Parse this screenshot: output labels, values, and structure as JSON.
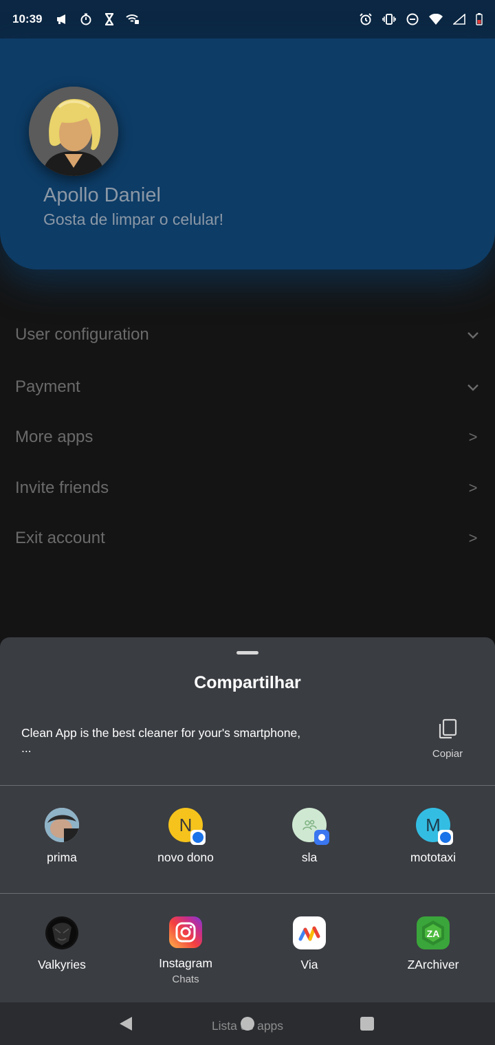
{
  "status_bar": {
    "time": "10:39",
    "left_icons": [
      "megaphone-icon",
      "stopwatch-icon",
      "hourglass-icon",
      "wifi-calling-icon"
    ],
    "right_icons": [
      "alarm-icon",
      "vibrate-icon",
      "dnd-icon",
      "wifi-icon",
      "signal-icon",
      "battery-icon"
    ]
  },
  "profile": {
    "name": "Apollo Daniel",
    "tagline": "Gosta de limpar o celular!"
  },
  "menu": [
    {
      "label": "User configuration",
      "arrow": "chevron-down"
    },
    {
      "label": "Payment",
      "arrow": "chevron-down"
    },
    {
      "label": "More apps",
      "arrow": ">"
    },
    {
      "label": "Invite friends",
      "arrow": ">"
    },
    {
      "label": "Exit account",
      "arrow": ">"
    }
  ],
  "share_sheet": {
    "title": "Compartilhar",
    "text_line1": "Clean App is the best cleaner for your's smartphone,",
    "text_line2": "...",
    "copy_label": "Copiar",
    "contacts": [
      {
        "label": "prima"
      },
      {
        "label": "novo dono",
        "initial": "N"
      },
      {
        "label": "sla"
      },
      {
        "label": "mototaxi",
        "initial": "M"
      }
    ],
    "apps": [
      {
        "label": "Valkyries"
      },
      {
        "label": "Instagram",
        "sublabel": "Chats"
      },
      {
        "label": "Via"
      },
      {
        "label": "ZArchiver",
        "glyph": "ZA"
      }
    ]
  },
  "nav": {
    "hint": "Lista de apps"
  },
  "colors": {
    "header": "#0d3c66",
    "status_bar": "#0b2743",
    "sheet": "#3a3d42",
    "menu_text": "#6a6a6a"
  }
}
